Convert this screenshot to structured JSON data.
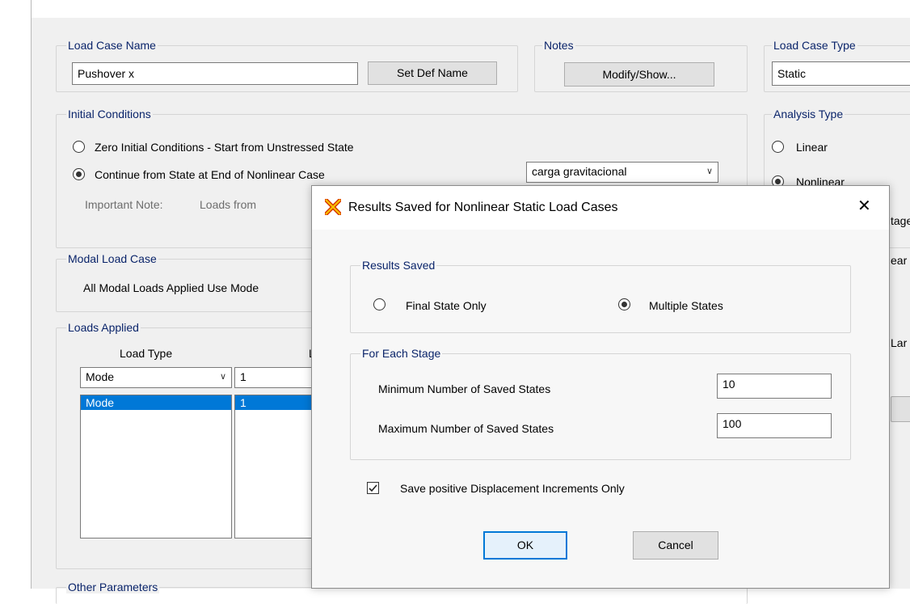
{
  "load_case_name": {
    "label": "Load Case Name",
    "value": "Pushover x",
    "set_def_button": "Set Def Name"
  },
  "notes": {
    "label": "Notes",
    "button": "Modify/Show..."
  },
  "load_case_type": {
    "label": "Load Case Type",
    "value": "Static"
  },
  "initial_conditions": {
    "label": "Initial Conditions",
    "zero_option": "Zero Initial Conditions - Start from Unstressed State",
    "continue_option": "Continue from State at End of Nonlinear Case",
    "nonlinear_case": "carga gravitacional",
    "note_label": "Important Note:",
    "note_text": "Loads from"
  },
  "analysis_type": {
    "label": "Analysis Type",
    "linear": "Linear",
    "nonlinear": "Nonlinear",
    "partial_right_1": "tage",
    "partial_right_2": "ear",
    "partial_right_3": "Lar"
  },
  "modal_load_case": {
    "label": "Modal Load Case",
    "text": "All Modal Loads Applied Use Mode"
  },
  "loads_applied": {
    "label": "Loads Applied",
    "col_load_type": "Load Type",
    "col_load_name_partial": "L",
    "type_combo": "Mode",
    "name_input": "1",
    "rows": [
      {
        "type": "Mode",
        "name": "1"
      }
    ]
  },
  "other_parameters": {
    "label": "Other Parameters"
  },
  "dialog": {
    "title": "Results Saved for Nonlinear Static Load Cases",
    "results_saved_label": "Results Saved",
    "final_state_only": "Final State Only",
    "multiple_states": "Multiple States",
    "for_each_stage_label": "For Each Stage",
    "min_states_label": "Minimum Number of Saved States",
    "min_states_value": "10",
    "max_states_label": "Maximum Number of Saved States",
    "max_states_value": "100",
    "save_positive_label": "Save positive Displacement Increments Only",
    "ok": "OK",
    "cancel": "Cancel",
    "close_glyph": "✕"
  },
  "colors": {
    "group_label": "#0a246a",
    "selection": "#0078d7",
    "dialog_bg": "#f7f7f7",
    "form_bg": "#f0f0f0"
  }
}
